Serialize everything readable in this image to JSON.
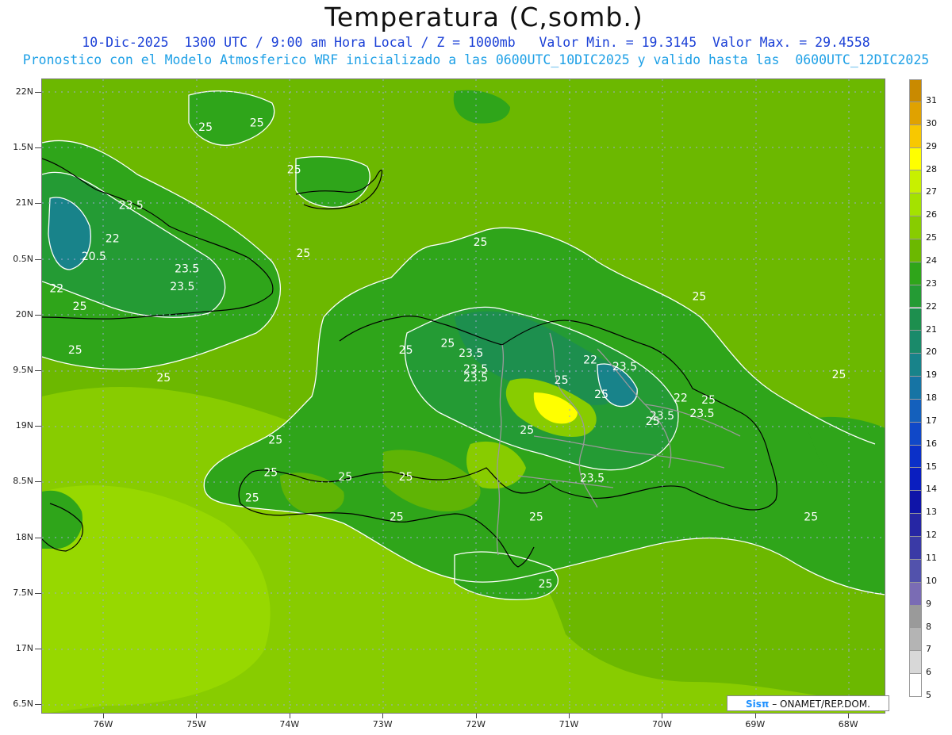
{
  "title": "Temperatura (C,somb.)",
  "subtitle1": "10-Dic-2025  1300 UTC / 9:00 am Hora Local / Z = 1000mb   Valor Min. = 19.3145  Valor Max. = 29.4558",
  "subtitle2": "Pronostico con el Modelo Atmosferico WRF inicializado a las 0600UTC_10DIC2025 y valido hasta las  0600UTC_12DIC2025",
  "y_axis": [
    "22N",
    "1.5N",
    "21N",
    "0.5N",
    "20N",
    "9.5N",
    "19N",
    "8.5N",
    "18N",
    "7.5N",
    "17N",
    "6.5N"
  ],
  "x_axis": [
    "76W",
    "75W",
    "74W",
    "73W",
    "72W",
    "71W",
    "70W",
    "69W",
    "68W"
  ],
  "colorbar": {
    "levels": [
      "31",
      "30",
      "29",
      "28",
      "27",
      "26",
      "25",
      "24",
      "23",
      "22",
      "21",
      "20",
      "19",
      "18",
      "17",
      "16",
      "15",
      "14",
      "13",
      "12",
      "11",
      "10",
      "9",
      "8",
      "7",
      "6",
      "5"
    ],
    "colors": [
      "#c98a00",
      "#e0a200",
      "#f8c800",
      "#ffff00",
      "#c8f000",
      "#a4e200",
      "#88cc00",
      "#6cb800",
      "#2fa51a",
      "#249b34",
      "#1d8f4e",
      "#1a8a6a",
      "#18838a",
      "#1674a4",
      "#1460bc",
      "#1048c8",
      "#0b30c8",
      "#0a1ec0",
      "#0f14a8",
      "#2626a4",
      "#3a3aa6",
      "#5252ac",
      "#7a6cb4",
      "#9a9a9a",
      "#b4b4b4",
      "#d8d8d8",
      "#ffffff"
    ]
  },
  "contour_labels": [
    {
      "text": "25",
      "lon": -75.1,
      "lat": 21.65
    },
    {
      "text": "25",
      "lon": -74.55,
      "lat": 21.69
    },
    {
      "text": "23.5",
      "lon": -75.9,
      "lat": 20.95
    },
    {
      "text": "22",
      "lon": -76.1,
      "lat": 20.65
    },
    {
      "text": "20.5",
      "lon": -76.3,
      "lat": 20.49
    },
    {
      "text": "23.5",
      "lon": -75.3,
      "lat": 20.38
    },
    {
      "text": "23.5",
      "lon": -75.35,
      "lat": 20.22
    },
    {
      "text": "22",
      "lon": -76.7,
      "lat": 20.2
    },
    {
      "text": "25",
      "lon": -76.45,
      "lat": 20.04
    },
    {
      "text": "25",
      "lon": -76.5,
      "lat": 19.65
    },
    {
      "text": "25",
      "lon": -75.55,
      "lat": 19.4
    },
    {
      "text": "25",
      "lon": -74.15,
      "lat": 21.27
    },
    {
      "text": "25",
      "lon": -74.05,
      "lat": 20.52
    },
    {
      "text": "25",
      "lon": -72.15,
      "lat": 20.62
    },
    {
      "text": "25",
      "lon": -69.8,
      "lat": 20.13
    },
    {
      "text": "25",
      "lon": -72.95,
      "lat": 19.65
    },
    {
      "text": "25",
      "lon": -72.5,
      "lat": 19.71
    },
    {
      "text": "23.5",
      "lon": -72.25,
      "lat": 19.62
    },
    {
      "text": "23.5",
      "lon": -72.2,
      "lat": 19.48
    },
    {
      "text": "23.5",
      "lon": -72.2,
      "lat": 19.4
    },
    {
      "text": "22",
      "lon": -70.97,
      "lat": 19.56
    },
    {
      "text": "23.5",
      "lon": -70.6,
      "lat": 19.5
    },
    {
      "text": "25",
      "lon": -71.28,
      "lat": 19.38
    },
    {
      "text": "25",
      "lon": -69.7,
      "lat": 19.2
    },
    {
      "text": "25",
      "lon": -70.85,
      "lat": 19.25
    },
    {
      "text": "25",
      "lon": -70.3,
      "lat": 19.01
    },
    {
      "text": "22",
      "lon": -70.0,
      "lat": 19.22
    },
    {
      "text": "23.5",
      "lon": -70.2,
      "lat": 19.06
    },
    {
      "text": "23.5",
      "lon": -69.77,
      "lat": 19.08
    },
    {
      "text": "25",
      "lon": -68.3,
      "lat": 19.43
    },
    {
      "text": "25",
      "lon": -71.65,
      "lat": 18.93
    },
    {
      "text": "25",
      "lon": -74.35,
      "lat": 18.84
    },
    {
      "text": "25",
      "lon": -74.4,
      "lat": 18.55
    },
    {
      "text": "25",
      "lon": -73.6,
      "lat": 18.51
    },
    {
      "text": "25",
      "lon": -72.95,
      "lat": 18.51
    },
    {
      "text": "23.5",
      "lon": -70.95,
      "lat": 18.5
    },
    {
      "text": "25",
      "lon": -74.6,
      "lat": 18.32
    },
    {
      "text": "25",
      "lon": -73.05,
      "lat": 18.15
    },
    {
      "text": "25",
      "lon": -71.55,
      "lat": 18.15
    },
    {
      "text": "25",
      "lon": -68.6,
      "lat": 18.15
    },
    {
      "text": "25",
      "lon": -71.45,
      "lat": 17.55
    }
  ],
  "credit": {
    "sis": "Sisπ",
    "org": " – ONAMET/REP.DOM."
  }
}
